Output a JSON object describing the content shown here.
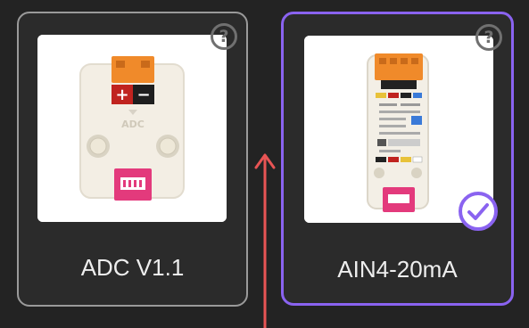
{
  "options": [
    {
      "label": "ADC V1.1",
      "help_icon": "question-circle-icon",
      "image": "adc-v1.1-unit-image",
      "selected": false
    },
    {
      "label": "AIN4-20mA",
      "help_icon": "question-circle-icon",
      "image": "ain4-20ma-unit-image",
      "selected": true,
      "selected_icon": "check-circle-icon"
    }
  ],
  "annotation": {
    "icon": "arrow-up-icon",
    "color": "#e85454"
  },
  "colors": {
    "selected_border": "#8a63f0",
    "unselected_border": "#9a9a9a",
    "background": "#232323"
  },
  "images": {
    "adc_plus": "+",
    "adc_minus": "−",
    "adc_text": "ADC"
  }
}
